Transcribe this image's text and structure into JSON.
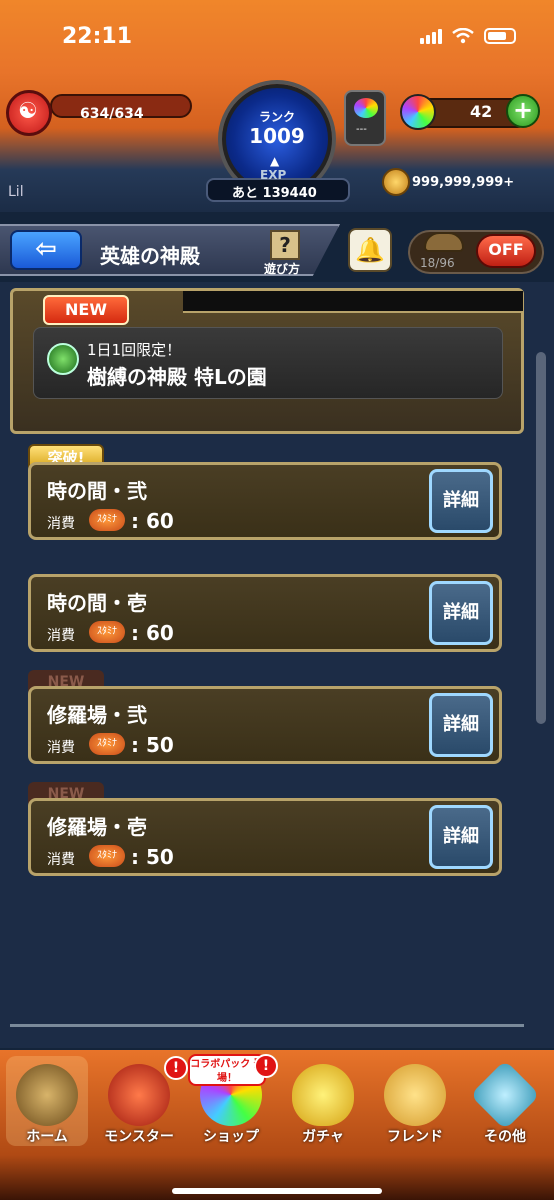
{
  "status_bar": {
    "time": "22:11"
  },
  "header": {
    "hp": "634/634",
    "rank_label": "ランク",
    "rank_value": "1009",
    "exp_label": "EXP",
    "exp_remaining": "あと 139440",
    "potion_label": "---",
    "gem_count": "42",
    "player_name": "Lil",
    "coins": "999,999,999+"
  },
  "title_bar": {
    "back_symbol": "⇦",
    "title": "英雄の神殿",
    "help_symbol": "?",
    "help_label": "遊び方",
    "toggle_count": "18/96",
    "toggle_label": "OFF"
  },
  "featured": {
    "badge": "NEW",
    "subtitle": "1日1回限定！",
    "title": "樹縛の神殿 特Lの園"
  },
  "quests": [
    {
      "badge": "突破!",
      "name": "時の間・弐",
      "cost_label": "消費",
      "stamina_label": "ｽﾀﾐﾅ",
      "cost": ": 60",
      "detail": "詳細"
    },
    {
      "badge": "",
      "name": "時の間・壱",
      "cost_label": "消費",
      "stamina_label": "ｽﾀﾐﾅ",
      "cost": ": 60",
      "detail": "詳細"
    },
    {
      "badge": "NEW",
      "name": "修羅場・弐",
      "cost_label": "消費",
      "stamina_label": "ｽﾀﾐﾅ",
      "cost": ": 50",
      "detail": "詳細"
    },
    {
      "badge": "NEW",
      "name": "修羅場・壱",
      "cost_label": "消費",
      "stamina_label": "ｽﾀﾐﾅ",
      "cost": ": 50",
      "detail": "詳細"
    }
  ],
  "bottom_nav": {
    "items": [
      {
        "label": "ホーム",
        "icon": "home-gate-icon"
      },
      {
        "label": "モンスター",
        "icon": "dragon-icon"
      },
      {
        "label": "ショップ",
        "icon": "rainbow-orb-icon"
      },
      {
        "label": "ガチャ",
        "icon": "egg-icon"
      },
      {
        "label": "フレンド",
        "icon": "friends-icon"
      },
      {
        "label": "その他",
        "icon": "options-icon"
      }
    ],
    "shop_banner": "コラボパック 登場！",
    "alert_symbol": "!"
  },
  "colors": {
    "accent_orange": "#e8742a",
    "panel_gold": "#b8a36a",
    "detail_blue": "#9fd8ff"
  }
}
